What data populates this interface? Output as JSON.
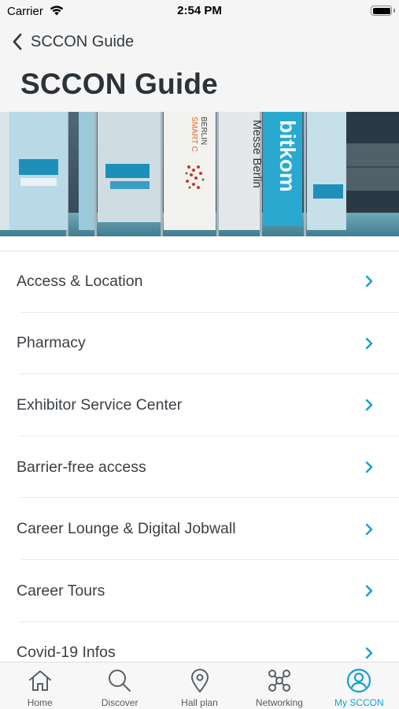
{
  "status_bar": {
    "carrier": "Carrier",
    "time": "2:54 PM"
  },
  "nav": {
    "back_label": "SCCON Guide",
    "title": "SCCON Guide"
  },
  "hero": {
    "banner_texts": [
      "SMART C",
      "BERLIN",
      "Messe Berlin",
      "bitkom"
    ]
  },
  "list": {
    "items": [
      {
        "label": "Access & Location"
      },
      {
        "label": "Pharmacy"
      },
      {
        "label": "Exhibitor Service Center"
      },
      {
        "label": "Barrier-free access"
      },
      {
        "label": "Career Lounge & Digital Jobwall"
      },
      {
        "label": "Career Tours"
      },
      {
        "label": "Covid-19 Infos"
      }
    ]
  },
  "tab_bar": {
    "items": [
      {
        "label": "Home",
        "icon": "home-icon"
      },
      {
        "label": "Discover",
        "icon": "search-icon"
      },
      {
        "label": "Hall plan",
        "icon": "location-pin-icon"
      },
      {
        "label": "Networking",
        "icon": "network-icon"
      },
      {
        "label": "My SCCON",
        "icon": "user-icon"
      }
    ],
    "active_index": 4
  },
  "colors": {
    "accent": "#14a0d2",
    "text": "#333a40",
    "nav_background": "#f5f5f5"
  }
}
